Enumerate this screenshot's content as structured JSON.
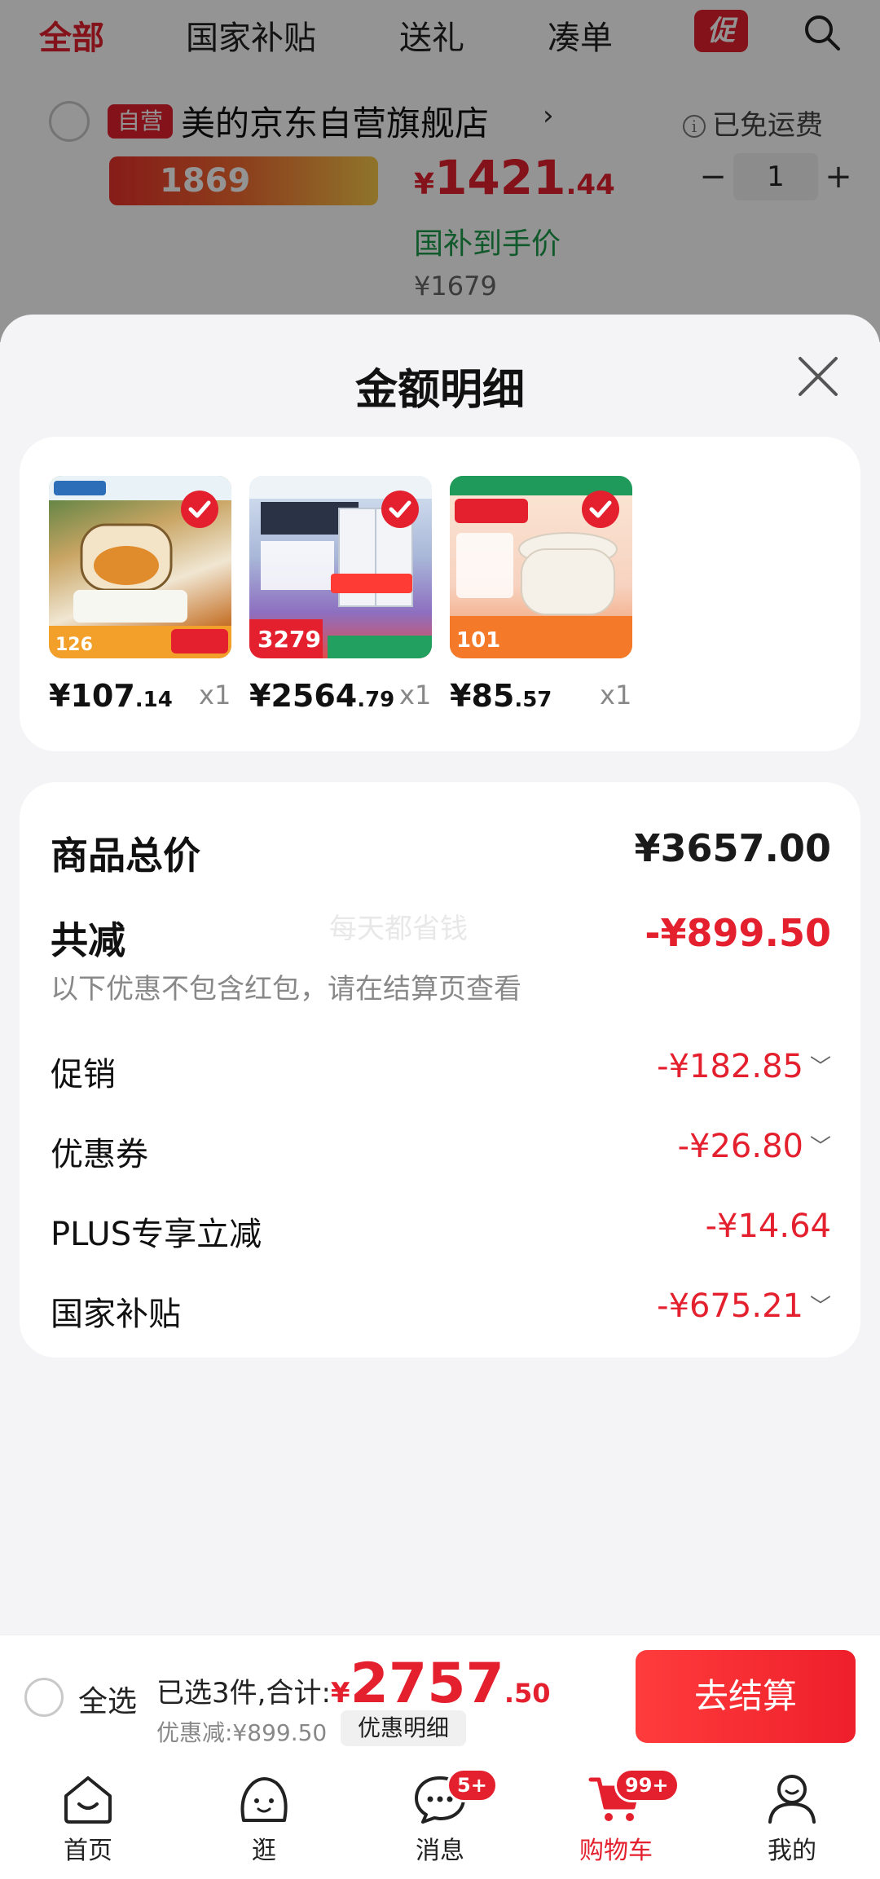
{
  "top_tabs": [
    "全部",
    "国家补贴",
    "送礼",
    "凑单"
  ],
  "promo_tab": "促",
  "store": {
    "self_tag": "自营",
    "name": "美的京东自营旗舰店",
    "shipping": "已免运费"
  },
  "bg_item": {
    "banner_price": "1869",
    "price_yen": "¥",
    "price_int": "1421",
    "price_dec": ".44",
    "subsidy_label": "国补到手价",
    "orig_price": "¥1679",
    "qty": "1"
  },
  "sheet": {
    "title": "金额明细"
  },
  "items": [
    {
      "price_int": "¥107",
      "price_dec": ".14",
      "qty": "x1"
    },
    {
      "price_int": "¥2564",
      "price_dec": ".79",
      "qty": "x1"
    },
    {
      "price_int": "¥85",
      "price_dec": ".57",
      "qty": "x1"
    }
  ],
  "summary": {
    "total_label": "商品总价",
    "total_value": "¥3657.00",
    "watermark": "每天都省钱",
    "reduce_label": "共减",
    "reduce_value": "-¥899.50",
    "note": "以下优惠不包含红包，请在结算页查看",
    "rows": [
      {
        "label": "促销",
        "value": "-¥182.85"
      },
      {
        "label": "优惠券",
        "value": "-¥26.80"
      },
      {
        "label": "PLUS专享立减",
        "value": "-¥14.64"
      },
      {
        "label": "国家补贴",
        "value": "-¥675.21"
      }
    ]
  },
  "checkout": {
    "select_all": "全选",
    "selected_text": "已选3件,合计:",
    "total_yen": "¥",
    "total_int": "2757",
    "total_dec": ".50",
    "discount": "优惠减:¥899.50",
    "detail_btn": "优惠明细",
    "checkout_btn": "去结算"
  },
  "tab_bar": {
    "tabs": [
      "首页",
      "逛",
      "消息",
      "购物车",
      "我的"
    ],
    "messages_badge": "5+",
    "cart_badge": "99+"
  },
  "colors": {
    "accent": "#e4202e",
    "green": "#1c9a4b"
  }
}
